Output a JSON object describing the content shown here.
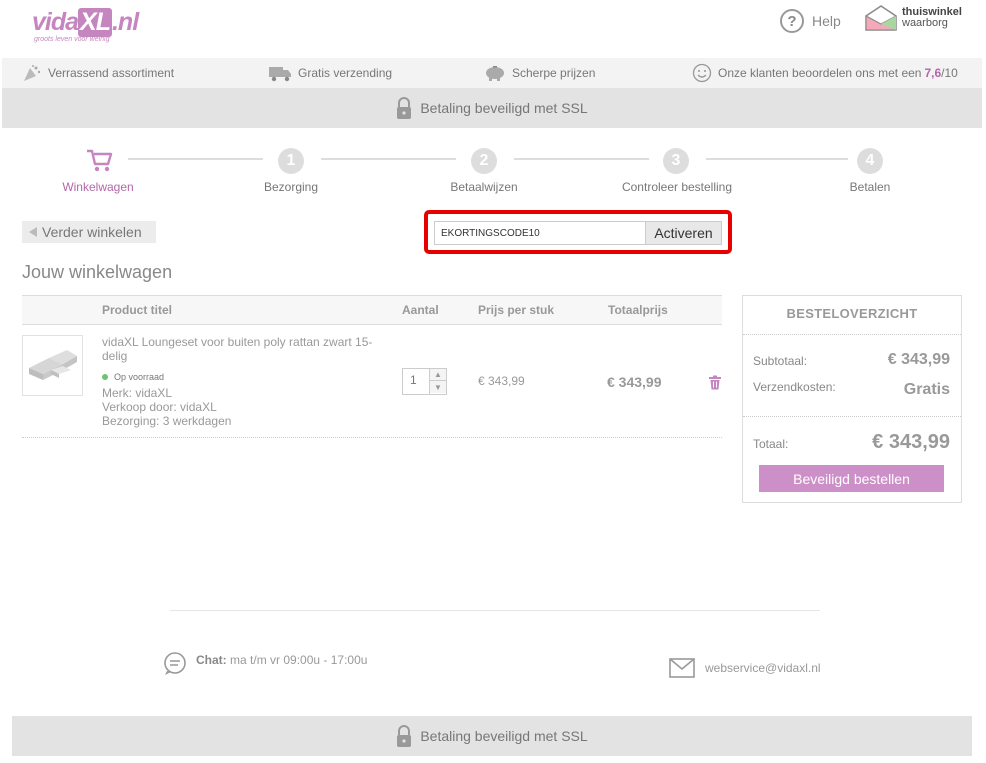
{
  "header": {
    "logo_text_main": "vida",
    "logo_text_box": "XL",
    "logo_text_suffix": ".nl",
    "logo_tagline": "groots leven voor weinig",
    "help_label": "Help",
    "help_icon": "?",
    "trust_line1": "thuiswinkel",
    "trust_line2": "waarborg"
  },
  "usps": {
    "assortment": "Verrassend assortiment",
    "shipping": "Gratis verzending",
    "prices": "Scherpe prijzen",
    "rating_prefix": "Onze klanten beoordelen ons met een",
    "rating_value": "7,6",
    "rating_suffix": "/10"
  },
  "ssl": {
    "top_label": "Betaling beveiligd met SSL",
    "bottom_label": "Betaling beveiligd met SSL"
  },
  "steps": [
    {
      "number": "",
      "label": "Winkelwagen",
      "active": true
    },
    {
      "number": "1",
      "label": "Bezorging",
      "active": false
    },
    {
      "number": "2",
      "label": "Betaalwijzen",
      "active": false
    },
    {
      "number": "3",
      "label": "Controleer bestelling",
      "active": false
    },
    {
      "number": "4",
      "label": "Betalen",
      "active": false
    }
  ],
  "continue_label": "Verder winkelen",
  "coupon": {
    "value": "EKORTINGSCODE10",
    "button_label": "Activeren"
  },
  "cart": {
    "title": "Jouw winkelwagen",
    "columns": {
      "product": "Product titel",
      "qty": "Aantal",
      "unit_price": "Prijs per stuk",
      "total": "Totaalprijs"
    },
    "items": [
      {
        "title": "vidaXL Loungeset voor buiten poly rattan zwart 15-delig",
        "stock": "Op voorraad",
        "brand": "Merk: vidaXL",
        "seller": "Verkoop door: vidaXL",
        "delivery": "Bezorging: 3 werkdagen",
        "quantity": "1",
        "unit_price": "€ 343,99",
        "total_price": "€ 343,99"
      }
    ]
  },
  "summary": {
    "title": "BESTELOVERZICHT",
    "subtotal_label": "Subtotaal:",
    "subtotal_value": "€ 343,99",
    "shipping_label": "Verzendkosten:",
    "shipping_value": "Gratis",
    "total_label": "Totaal:",
    "total_value": "€ 343,99",
    "order_button": "Beveiligd bestellen"
  },
  "footer": {
    "chat_label": "Chat:",
    "chat_hours": "ma t/m vr 09:00u - 17:00u",
    "email": "webservice@vidaxl.nl"
  },
  "colors": {
    "brand": "#c586c0",
    "highlight": "#e60000",
    "stock": "#6cc46c"
  }
}
